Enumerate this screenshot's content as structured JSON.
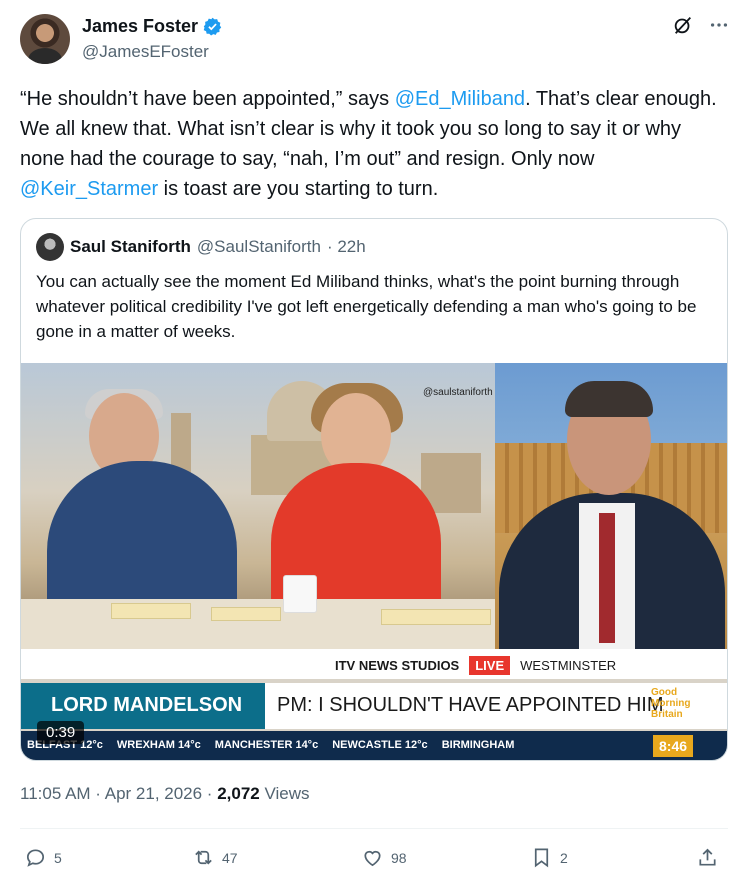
{
  "tweet": {
    "author_name": "James Foster",
    "author_handle": "@JamesEFoster",
    "text_parts": {
      "p1": "“He shouldn’t have been appointed,” says ",
      "m1": "@Ed_Miliband",
      "p2": ". That’s clear enough. We all knew that.  What isn’t clear is why it took you so long to say it or why none had the courage to say, “nah, I’m out” and resign. Only now ",
      "m2": "@Keir_Starmer",
      "p3": " is toast are you starting to turn."
    },
    "timestamp": "11:05 AM · Apr 21, 2026 · ",
    "views_count": "2,072",
    "views_label": " Views"
  },
  "quote": {
    "author_name": "Saul Staniforth",
    "author_handle": "@SaulStaniforth",
    "time": "· 22h",
    "text": "You can actually see the moment Ed Miliband thinks, what's the point burning through whatever political credibility I've got left energetically defending a man who's going to be gone in a matter of weeks."
  },
  "video": {
    "watermark": "@saulstaniforth",
    "strap_brand": "ITV NEWS STUDIOS",
    "strap_live": "LIVE",
    "strap_location": "WESTMINSTER",
    "lower_left": "LORD MANDELSON",
    "lower_right": "PM: I SHOULDN'T HAVE APPOINTED HIM",
    "gmb_logo": "Good Morning Britain",
    "ticker": [
      "BELFAST 12°c",
      "WREXHAM 14°c",
      "MANCHESTER 14°c",
      "NEWCASTLE 12°c",
      "BIRMINGHAM"
    ],
    "clock": "8:46",
    "duration": "0:39"
  },
  "actions": {
    "replies": "5",
    "reposts": "47",
    "likes": "98",
    "bookmarks": "2"
  },
  "colors": {
    "link": "#1d9bf0",
    "muted": "#536471",
    "live": "#e8362d",
    "itv_teal": "#0c6e8a"
  }
}
